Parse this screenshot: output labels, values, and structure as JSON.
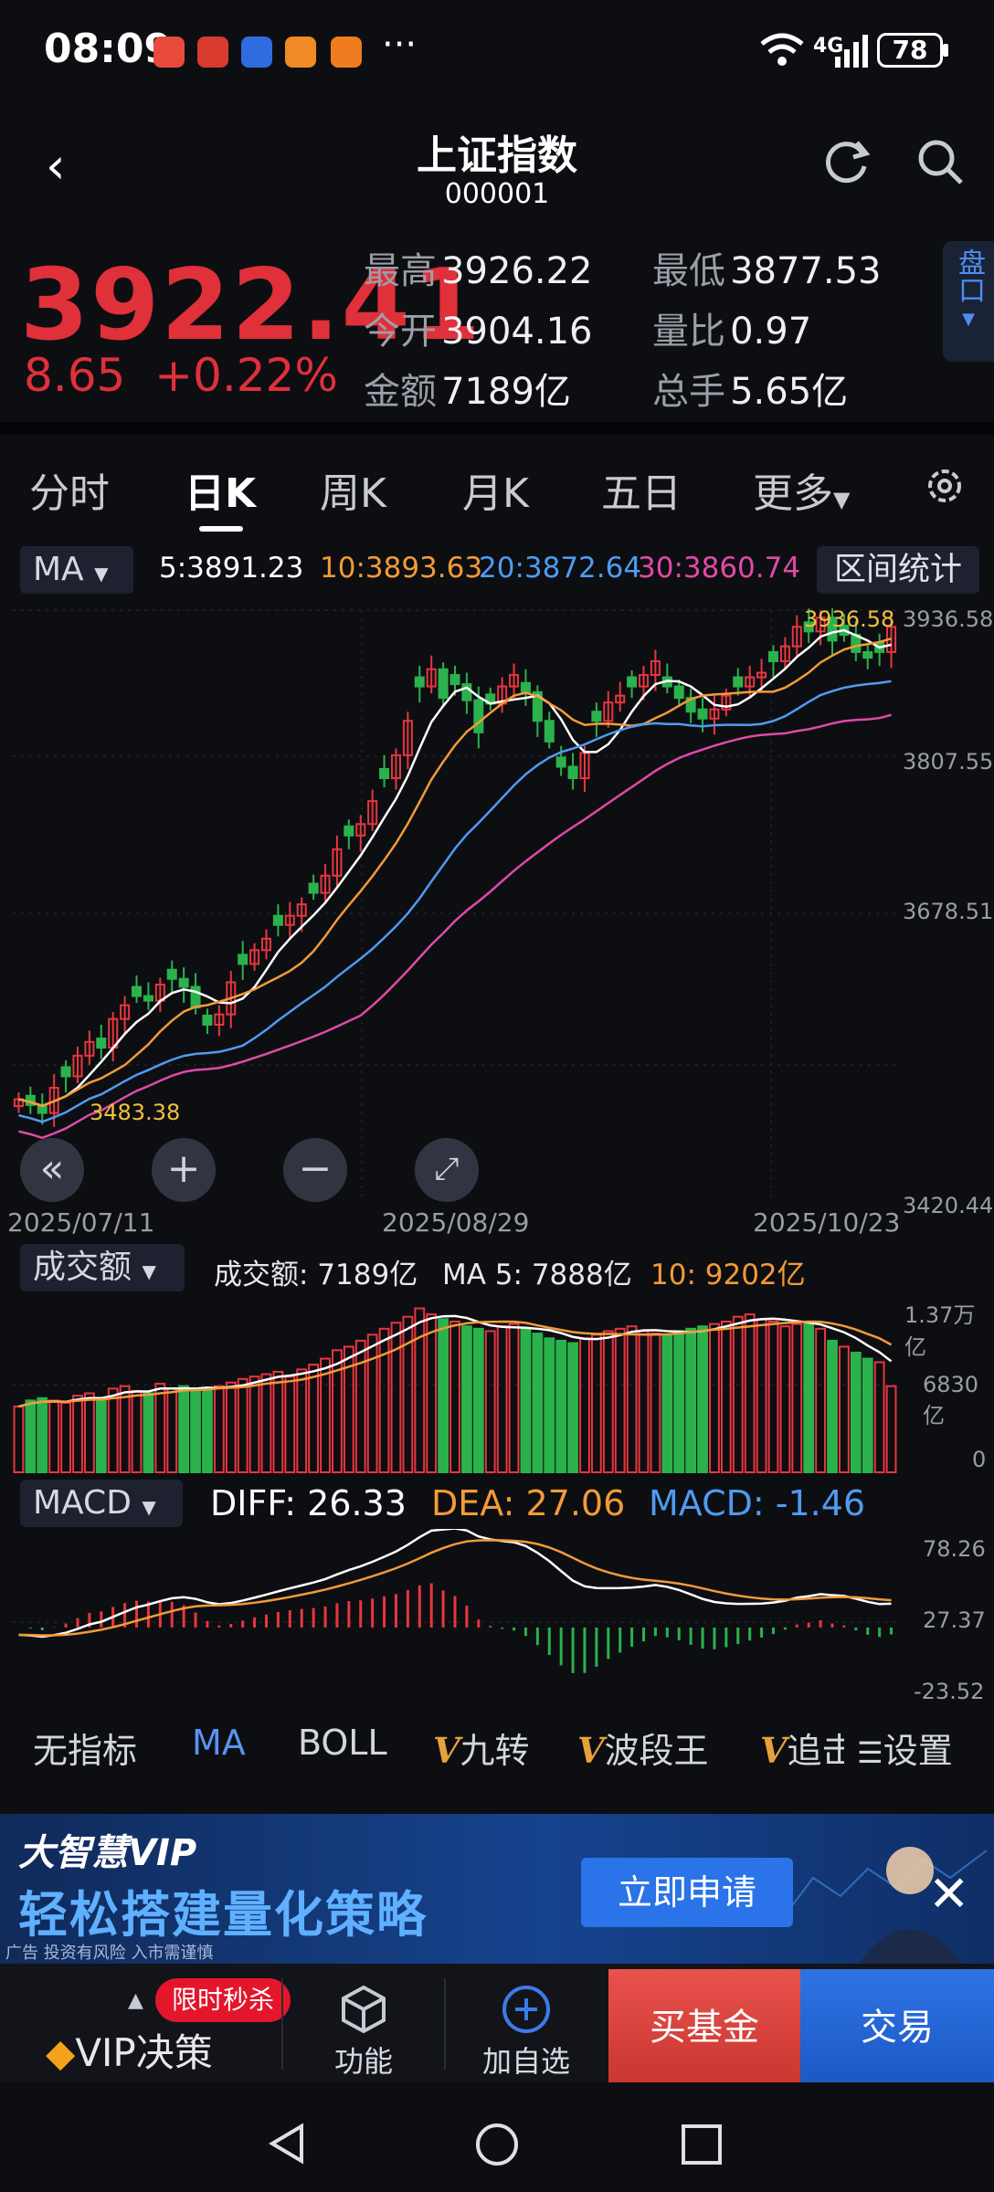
{
  "status_bar": {
    "time": "08:09",
    "network": "4G",
    "battery": "78",
    "more": "···",
    "app_icons": [
      {
        "name": "news-app-icon",
        "color": "#e84a3c"
      },
      {
        "name": "finance-app-icon",
        "color": "#d83a2e"
      },
      {
        "name": "blue-app-icon",
        "color": "#2f6ce0"
      },
      {
        "name": "orange-app-icon-1",
        "color": "#f08a24"
      },
      {
        "name": "orange-app-icon-2",
        "color": "#ef7d1f"
      }
    ]
  },
  "header": {
    "back": "‹",
    "title": "上证指数",
    "code": "000001"
  },
  "quote": {
    "price": "3922.41",
    "change": "8.65",
    "change_pct": "+0.22%",
    "fields": [
      {
        "label": "最高",
        "value": "3926.22",
        "color": "#f0f0f4"
      },
      {
        "label": "最低",
        "value": "3877.53",
        "color": "#f0f0f4"
      },
      {
        "label": "今开",
        "value": "3904.16",
        "color": "#f0f0f4"
      },
      {
        "label": "量比",
        "value": "0.97",
        "color": "#f0f0f4"
      },
      {
        "label": "金额",
        "value": "7189亿",
        "color": "#f0f0f4"
      },
      {
        "label": "总手",
        "value": "5.65亿",
        "color": "#f0f0f4"
      }
    ],
    "pankou": "盘口"
  },
  "tabs": [
    "分时",
    "日K",
    "周K",
    "月K",
    "五日",
    "更多"
  ],
  "ma_row": {
    "select": "MA",
    "items": [
      {
        "text": "5:3891.23",
        "color": "#ffffff"
      },
      {
        "text": "10:3893.63",
        "color": "#f29a38"
      },
      {
        "text": "20:3872.64",
        "color": "#4f9bf0"
      },
      {
        "text": "30:3860.74",
        "color": "#e04aa8"
      }
    ],
    "stat_button": "区间统计"
  },
  "kline": {
    "y_labels": [
      "3936.58",
      "3807.55",
      "3678.51",
      "3420.44"
    ],
    "dates": [
      "2025/07/11",
      "2025/08/29",
      "2025/10/23"
    ],
    "high_mark": "3936.58",
    "low_mark": "3483.38"
  },
  "volume": {
    "select": "成交额",
    "items": [
      {
        "text": "成交额: 7189亿",
        "color": "#e6e8ee"
      },
      {
        "text": "MA 5: 7888亿",
        "color": "#e6e8ee"
      },
      {
        "text": "10: 9202亿",
        "color": "#f29a38"
      }
    ],
    "y_labels": [
      "1.37万亿",
      "6830亿",
      "0"
    ]
  },
  "macd": {
    "select": "MACD",
    "diff": "DIFF: 26.33",
    "dea": "DEA: 27.06",
    "macd": "MACD: -1.46",
    "y_labels": [
      "78.26",
      "27.37",
      "-23.52"
    ]
  },
  "indicators": [
    "无指标",
    "MA",
    "BOLL",
    "九转",
    "波段王",
    "追击",
    "设置"
  ],
  "ad": {
    "brand": "大智慧VIP",
    "slogan": "轻松搭建量化策略",
    "fine_print": "广告 投资有风险 入市需谨慎",
    "apply": "立即申请"
  },
  "bottom_bar": {
    "flash_tag": "限时秒杀",
    "vip": "VIP决策",
    "function": "功能",
    "add_watch": "加自选",
    "buy_fund": "买基金",
    "trade": "交易"
  },
  "chart_data": {
    "type": "candlestick",
    "x_start": "2025/07/11",
    "x_mid": "2025/08/29",
    "x_end": "2025/10/23",
    "ylim": [
      3420.44,
      3936.58
    ],
    "closes": [
      3510,
      3505,
      3498,
      3520,
      3530,
      3548,
      3560,
      3555,
      3580,
      3592,
      3600,
      3596,
      3610,
      3615,
      3608,
      3590,
      3575,
      3584,
      3612,
      3628,
      3640,
      3650,
      3662,
      3670,
      3680,
      3690,
      3705,
      3728,
      3740,
      3750,
      3770,
      3790,
      3810,
      3840,
      3870,
      3885,
      3860,
      3872,
      3858,
      3830,
      3855,
      3870,
      3880,
      3865,
      3840,
      3822,
      3800,
      3790,
      3812,
      3840,
      3856,
      3862,
      3870,
      3880,
      3892,
      3870,
      3860,
      3848,
      3842,
      3850,
      3862,
      3870,
      3878,
      3882,
      3892,
      3905,
      3922,
      3918,
      3930,
      3910,
      3915,
      3900,
      3895,
      3900,
      3922
    ],
    "volume_10k_yi": [
      0.55,
      0.6,
      0.62,
      0.6,
      0.58,
      0.64,
      0.66,
      0.62,
      0.7,
      0.72,
      0.68,
      0.66,
      0.74,
      0.7,
      0.72,
      0.68,
      0.7,
      0.72,
      0.75,
      0.78,
      0.8,
      0.82,
      0.84,
      0.8,
      0.86,
      0.9,
      0.95,
      1.02,
      1.05,
      1.1,
      1.15,
      1.2,
      1.25,
      1.3,
      1.37,
      1.32,
      1.28,
      1.26,
      1.22,
      1.2,
      1.18,
      1.22,
      1.24,
      1.2,
      1.16,
      1.12,
      1.1,
      1.08,
      1.12,
      1.15,
      1.18,
      1.2,
      1.22,
      1.18,
      1.16,
      1.14,
      1.18,
      1.2,
      1.22,
      1.24,
      1.26,
      1.3,
      1.32,
      1.28,
      1.26,
      1.22,
      1.24,
      1.26,
      1.2,
      1.1,
      1.05,
      1.0,
      0.95,
      0.92,
      0.72
    ]
  }
}
